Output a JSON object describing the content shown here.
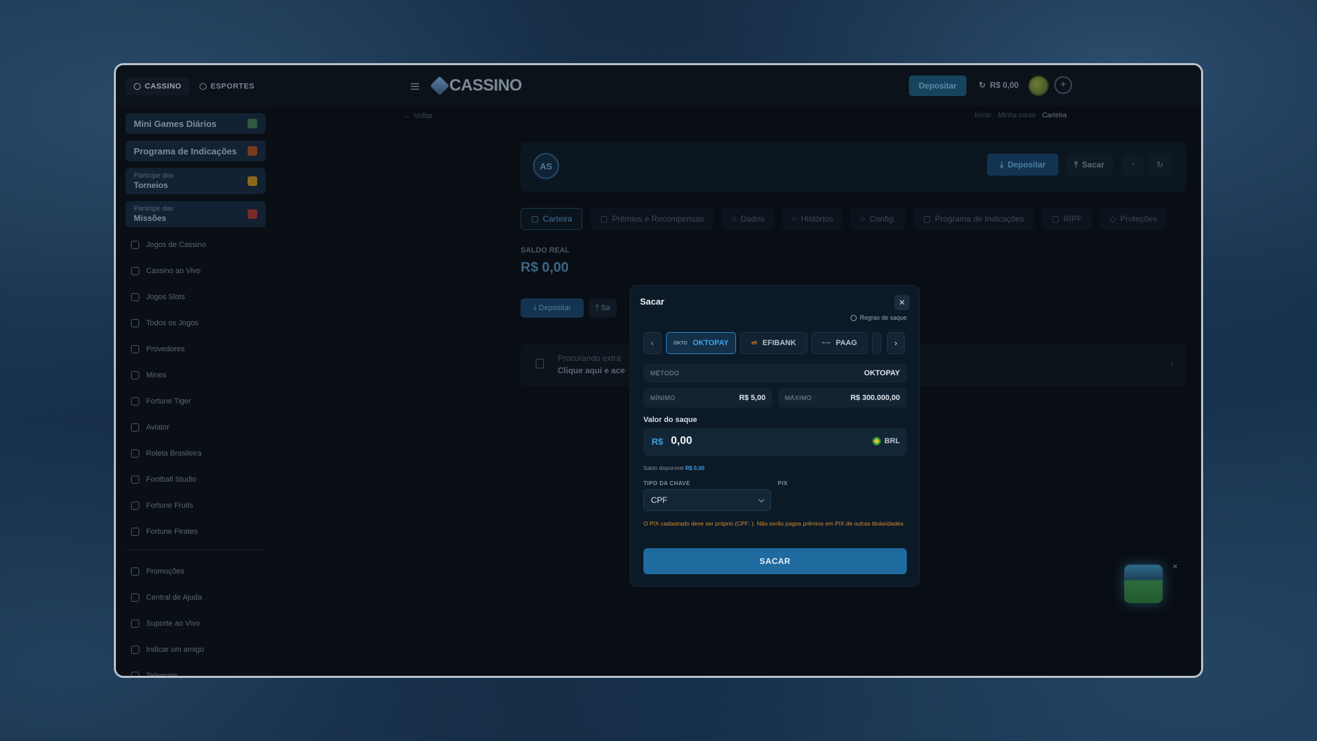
{
  "topbar": {
    "tabs": [
      {
        "label": "CASSINO",
        "icon": "casino-icon"
      },
      {
        "label": "ESPORTES",
        "icon": "ball-icon"
      }
    ],
    "logo_text": "CASSINO",
    "deposit_label": "Depositar",
    "balance": "R$ 0,00"
  },
  "sidebar": {
    "promos": [
      {
        "title": "Mini Games Diários"
      },
      {
        "title": "Programa de Indicações"
      },
      {
        "small": "Participe dos",
        "big": "Torneios"
      },
      {
        "small": "Participe das",
        "big": "Missões"
      }
    ],
    "nav": [
      {
        "label": "Jogos de Cassino",
        "icon": "cards-icon"
      },
      {
        "label": "Cassino ao Vivo",
        "icon": "live-icon"
      },
      {
        "label": "Jogos Slots",
        "icon": "slots-icon"
      },
      {
        "label": "Todos os Jogos",
        "icon": "games-icon"
      },
      {
        "label": "Provedores",
        "icon": "provider-icon"
      },
      {
        "label": "Mines",
        "icon": "mines-icon"
      },
      {
        "label": "Fortune Tiger",
        "icon": "tiger-icon"
      },
      {
        "label": "Aviator",
        "icon": "plane-icon"
      },
      {
        "label": "Roleta Brasileira",
        "icon": "roulette-icon"
      },
      {
        "label": "Football Studio",
        "icon": "football-icon"
      },
      {
        "label": "Fortune Fruits",
        "icon": "fruit-icon"
      },
      {
        "label": "Fortune Pirates",
        "icon": "pirate-icon"
      }
    ],
    "nav2": [
      {
        "label": "Promoções",
        "icon": "megaphone-icon"
      },
      {
        "label": "Central de Ajuda",
        "icon": "help-icon"
      },
      {
        "label": "Suporte ao Vivo",
        "icon": "chat-icon"
      },
      {
        "label": "Indicar um amigo",
        "icon": "gift-icon"
      },
      {
        "label": "Telegram",
        "icon": "telegram-icon"
      }
    ]
  },
  "page": {
    "back": "Voltar",
    "breadcrumbs": [
      "Início",
      "Minha conta",
      "Carteira"
    ],
    "avatar_initials": "AS",
    "deposit_label": "Depositar",
    "withdraw_label": "Sacar",
    "tabs": [
      "Carteira",
      "Prêmios e Recompensas",
      "Dados",
      "Histórico",
      "Config.",
      "Programa de Indicações",
      "IRPF",
      "Proteções"
    ],
    "saldo_label": "SALDO REAL",
    "saldo_value": "R$ 0,00",
    "saldo_deposit": "Depositar",
    "saldo_withdraw": "Sa",
    "extra_line1": "Procurando extra",
    "extra_line2": "Clique aqui e ace"
  },
  "modal": {
    "title": "Sacar",
    "rules": "Regras de saque",
    "methods": [
      {
        "tag": "OKTO",
        "label": "OKTOPAY",
        "active": true
      },
      {
        "tag": "efi",
        "label": "EFIBANK",
        "active": false
      },
      {
        "tag": "•—•",
        "label": "PAAG",
        "active": false
      }
    ],
    "method_key": "MÉTODO",
    "method_value": "OKTOPAY",
    "min_key": "MÍNIMO",
    "min_value": "R$ 5,00",
    "max_key": "MÁXIMO",
    "max_value": "R$ 300.000,00",
    "amount_label": "Valor do saque",
    "currency_symbol": "R$",
    "amount_value": "0,00",
    "currency_code": "BRL",
    "available_prefix": "Saldo disponível",
    "available_value": "R$ 0,00",
    "key_type_label": "TIPO DA CHAVE",
    "pix_label": "PIX",
    "key_type_value": "CPF",
    "warning": "O PIX cadastrado deve ser próprio (CPF: ). Não serão pagos prêmios em PIX de outras titularidades.",
    "submit_label": "SACAR"
  },
  "colors": {
    "accent": "#3ea3ea",
    "button": "#1f6a9f",
    "warning": "#d98b2b"
  }
}
